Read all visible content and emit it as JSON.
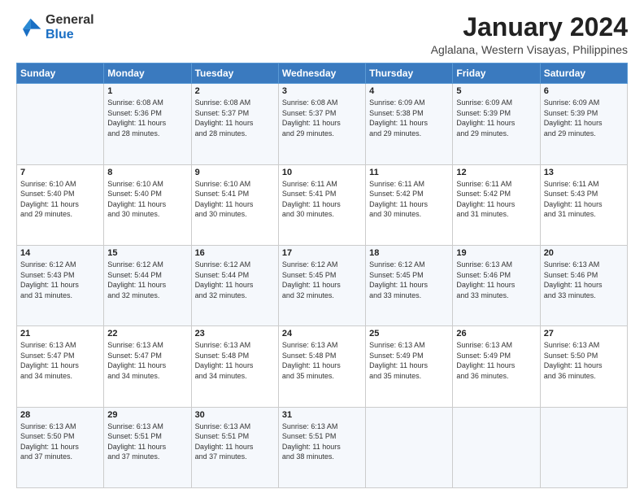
{
  "header": {
    "logo_general": "General",
    "logo_blue": "Blue",
    "title": "January 2024",
    "subtitle": "Aglalana, Western Visayas, Philippines"
  },
  "calendar": {
    "days_of_week": [
      "Sunday",
      "Monday",
      "Tuesday",
      "Wednesday",
      "Thursday",
      "Friday",
      "Saturday"
    ],
    "weeks": [
      [
        {
          "date": "",
          "info": ""
        },
        {
          "date": "1",
          "info": "Sunrise: 6:08 AM\nSunset: 5:36 PM\nDaylight: 11 hours\nand 28 minutes."
        },
        {
          "date": "2",
          "info": "Sunrise: 6:08 AM\nSunset: 5:37 PM\nDaylight: 11 hours\nand 28 minutes."
        },
        {
          "date": "3",
          "info": "Sunrise: 6:08 AM\nSunset: 5:37 PM\nDaylight: 11 hours\nand 29 minutes."
        },
        {
          "date": "4",
          "info": "Sunrise: 6:09 AM\nSunset: 5:38 PM\nDaylight: 11 hours\nand 29 minutes."
        },
        {
          "date": "5",
          "info": "Sunrise: 6:09 AM\nSunset: 5:39 PM\nDaylight: 11 hours\nand 29 minutes."
        },
        {
          "date": "6",
          "info": "Sunrise: 6:09 AM\nSunset: 5:39 PM\nDaylight: 11 hours\nand 29 minutes."
        }
      ],
      [
        {
          "date": "7",
          "info": "Sunrise: 6:10 AM\nSunset: 5:40 PM\nDaylight: 11 hours\nand 29 minutes."
        },
        {
          "date": "8",
          "info": "Sunrise: 6:10 AM\nSunset: 5:40 PM\nDaylight: 11 hours\nand 30 minutes."
        },
        {
          "date": "9",
          "info": "Sunrise: 6:10 AM\nSunset: 5:41 PM\nDaylight: 11 hours\nand 30 minutes."
        },
        {
          "date": "10",
          "info": "Sunrise: 6:11 AM\nSunset: 5:41 PM\nDaylight: 11 hours\nand 30 minutes."
        },
        {
          "date": "11",
          "info": "Sunrise: 6:11 AM\nSunset: 5:42 PM\nDaylight: 11 hours\nand 30 minutes."
        },
        {
          "date": "12",
          "info": "Sunrise: 6:11 AM\nSunset: 5:42 PM\nDaylight: 11 hours\nand 31 minutes."
        },
        {
          "date": "13",
          "info": "Sunrise: 6:11 AM\nSunset: 5:43 PM\nDaylight: 11 hours\nand 31 minutes."
        }
      ],
      [
        {
          "date": "14",
          "info": "Sunrise: 6:12 AM\nSunset: 5:43 PM\nDaylight: 11 hours\nand 31 minutes."
        },
        {
          "date": "15",
          "info": "Sunrise: 6:12 AM\nSunset: 5:44 PM\nDaylight: 11 hours\nand 32 minutes."
        },
        {
          "date": "16",
          "info": "Sunrise: 6:12 AM\nSunset: 5:44 PM\nDaylight: 11 hours\nand 32 minutes."
        },
        {
          "date": "17",
          "info": "Sunrise: 6:12 AM\nSunset: 5:45 PM\nDaylight: 11 hours\nand 32 minutes."
        },
        {
          "date": "18",
          "info": "Sunrise: 6:12 AM\nSunset: 5:45 PM\nDaylight: 11 hours\nand 33 minutes."
        },
        {
          "date": "19",
          "info": "Sunrise: 6:13 AM\nSunset: 5:46 PM\nDaylight: 11 hours\nand 33 minutes."
        },
        {
          "date": "20",
          "info": "Sunrise: 6:13 AM\nSunset: 5:46 PM\nDaylight: 11 hours\nand 33 minutes."
        }
      ],
      [
        {
          "date": "21",
          "info": "Sunrise: 6:13 AM\nSunset: 5:47 PM\nDaylight: 11 hours\nand 34 minutes."
        },
        {
          "date": "22",
          "info": "Sunrise: 6:13 AM\nSunset: 5:47 PM\nDaylight: 11 hours\nand 34 minutes."
        },
        {
          "date": "23",
          "info": "Sunrise: 6:13 AM\nSunset: 5:48 PM\nDaylight: 11 hours\nand 34 minutes."
        },
        {
          "date": "24",
          "info": "Sunrise: 6:13 AM\nSunset: 5:48 PM\nDaylight: 11 hours\nand 35 minutes."
        },
        {
          "date": "25",
          "info": "Sunrise: 6:13 AM\nSunset: 5:49 PM\nDaylight: 11 hours\nand 35 minutes."
        },
        {
          "date": "26",
          "info": "Sunrise: 6:13 AM\nSunset: 5:49 PM\nDaylight: 11 hours\nand 36 minutes."
        },
        {
          "date": "27",
          "info": "Sunrise: 6:13 AM\nSunset: 5:50 PM\nDaylight: 11 hours\nand 36 minutes."
        }
      ],
      [
        {
          "date": "28",
          "info": "Sunrise: 6:13 AM\nSunset: 5:50 PM\nDaylight: 11 hours\nand 37 minutes."
        },
        {
          "date": "29",
          "info": "Sunrise: 6:13 AM\nSunset: 5:51 PM\nDaylight: 11 hours\nand 37 minutes."
        },
        {
          "date": "30",
          "info": "Sunrise: 6:13 AM\nSunset: 5:51 PM\nDaylight: 11 hours\nand 37 minutes."
        },
        {
          "date": "31",
          "info": "Sunrise: 6:13 AM\nSunset: 5:51 PM\nDaylight: 11 hours\nand 38 minutes."
        },
        {
          "date": "",
          "info": ""
        },
        {
          "date": "",
          "info": ""
        },
        {
          "date": "",
          "info": ""
        }
      ]
    ]
  }
}
